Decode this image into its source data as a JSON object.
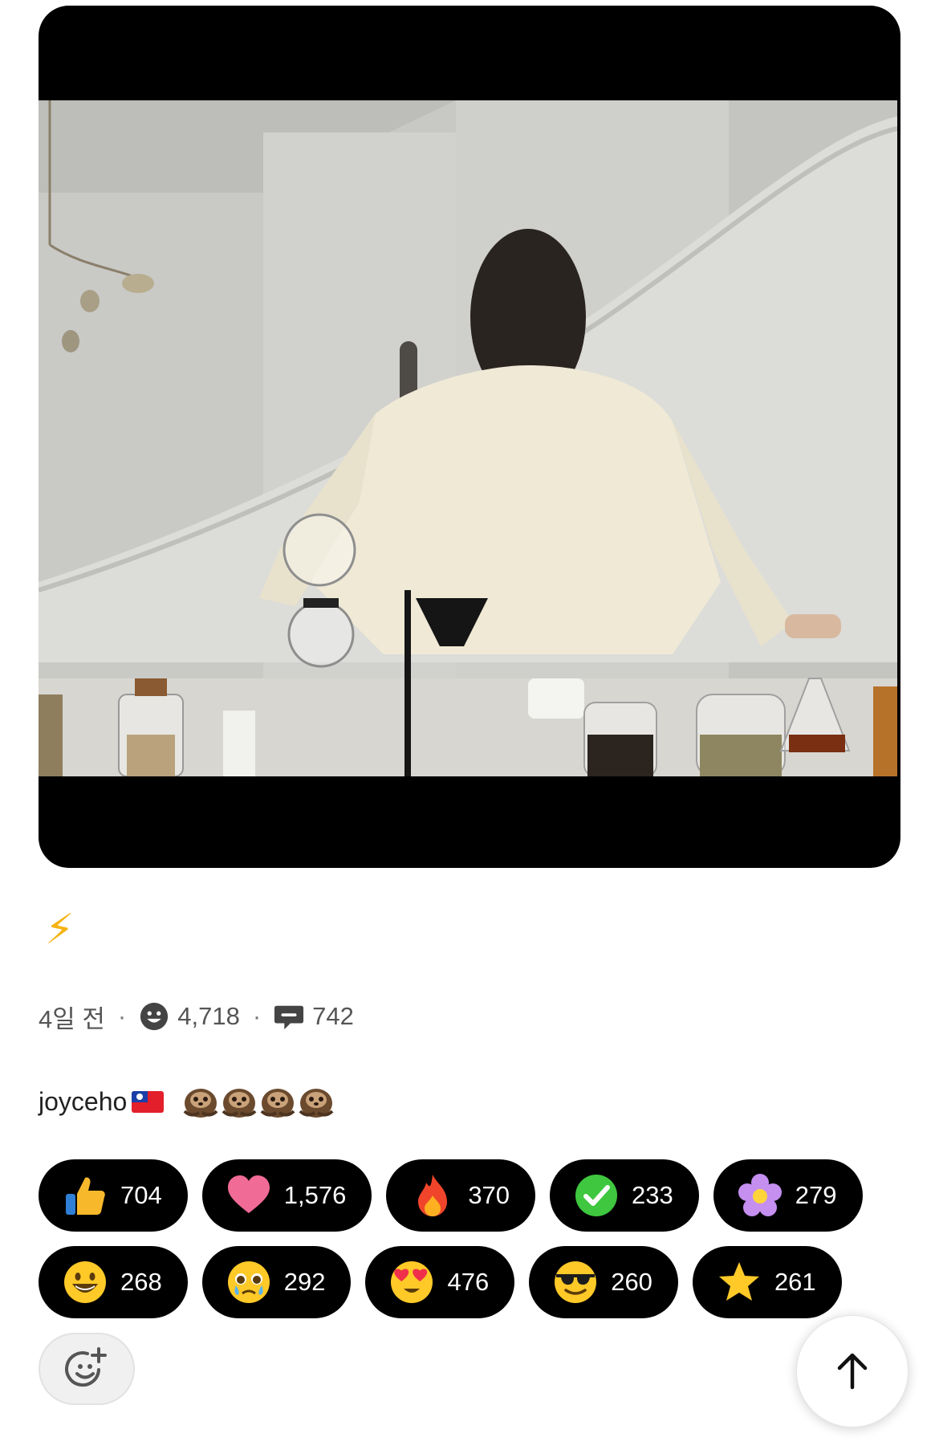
{
  "post": {
    "caption_icon": "lightning-icon",
    "time": "4일 전",
    "reactions_total": "4,718",
    "comments": "742",
    "author": "joyceho",
    "author_flag": "taiwan-flag-icon",
    "author_badges": [
      "sloth-icon",
      "sloth-icon",
      "sloth-icon",
      "sloth-icon"
    ]
  },
  "reactions": [
    {
      "icon": "thumbs-up-icon",
      "count": "704"
    },
    {
      "icon": "heart-icon",
      "count": "1,576"
    },
    {
      "icon": "fire-icon",
      "count": "370"
    },
    {
      "icon": "check-mark-icon",
      "count": "233"
    },
    {
      "icon": "flower-icon",
      "count": "279"
    },
    {
      "icon": "grinning-face-icon",
      "count": "268"
    },
    {
      "icon": "crying-face-icon",
      "count": "292"
    },
    {
      "icon": "heart-eyes-face-icon",
      "count": "476"
    },
    {
      "icon": "sunglasses-face-icon",
      "count": "260"
    },
    {
      "icon": "star-icon",
      "count": "261"
    }
  ],
  "controls": {
    "add_reaction_icon": "add-reaction-icon",
    "scroll_top_icon": "arrow-up-icon"
  },
  "colors": {
    "pill_bg": "#000000",
    "bolt": "#f6b414"
  }
}
